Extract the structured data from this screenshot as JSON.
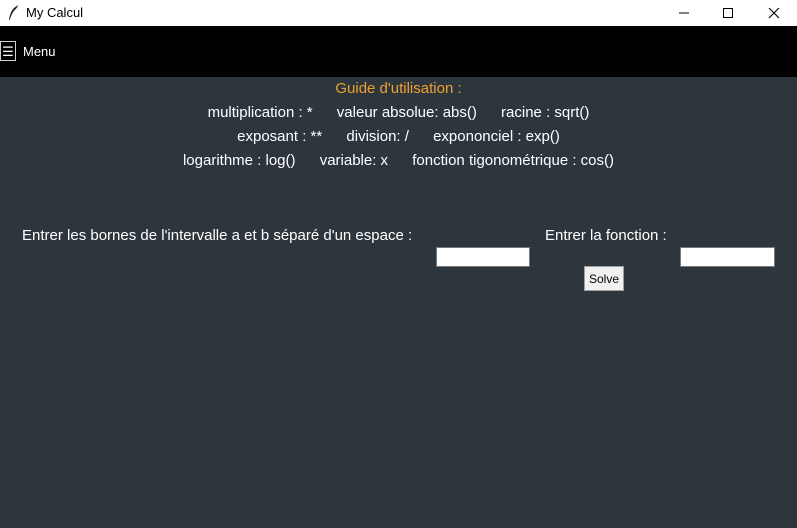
{
  "window": {
    "title": "My Calcul",
    "app_icon": "feather-icon",
    "controls": [
      "minimize-icon",
      "maximize-icon",
      "close-icon"
    ]
  },
  "menubar": {
    "hamburger_glyph": "☰",
    "menu_label": "Menu"
  },
  "guide": {
    "title": "Guide d'utilisation :",
    "line1": [
      "multiplication : *",
      "valeur absolue: abs()",
      "racine : sqrt()"
    ],
    "line2": [
      "exposant : **",
      "division: /",
      "expononciel : exp()"
    ],
    "line3": [
      "logarithme : log()",
      "variable: x",
      "fonction tigonométrique : cos()"
    ]
  },
  "form": {
    "interval_label": "Entrer les bornes de l'intervalle a et b séparé d'un espace  :",
    "interval_value": "",
    "function_label": "Entrer la fonction  :",
    "function_value": "",
    "solve_label": "Solve"
  },
  "colors": {
    "background": "#2d363d",
    "menubar": "#000000",
    "guide_title": "#f0a030",
    "text": "#ffffff"
  }
}
